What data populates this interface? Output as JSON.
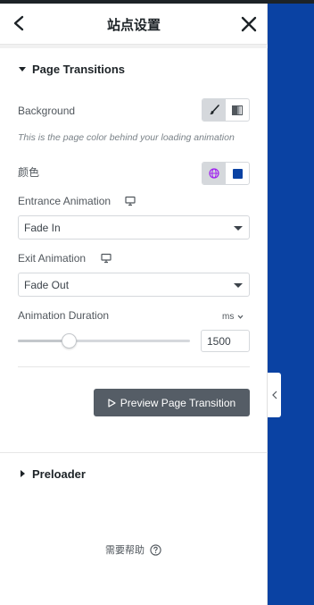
{
  "header": {
    "title": "站点设置"
  },
  "sections": {
    "page_transitions": {
      "label": "Page Transitions",
      "expanded": true
    },
    "preloader": {
      "label": "Preloader",
      "expanded": false
    }
  },
  "background": {
    "label": "Background",
    "options": [
      "brush-icon",
      "gradient-icon"
    ],
    "selected": "brush-icon",
    "hint": "This is the page color behind your loading animation"
  },
  "color": {
    "label": "颜色",
    "swatch": "#0a42a3"
  },
  "entrance": {
    "label": "Entrance Animation",
    "value": "Fade In"
  },
  "exit": {
    "label": "Exit Animation",
    "value": "Fade Out"
  },
  "duration": {
    "label": "Animation Duration",
    "unit": "ms",
    "value": "1500",
    "slider_fraction": 0.3
  },
  "preview_button": {
    "label": "Preview Page Transition"
  },
  "help": {
    "label": "需要帮助"
  },
  "colors": {
    "canvas": "#0a42a3",
    "button": "#555d66",
    "globe": "#a020f0"
  }
}
